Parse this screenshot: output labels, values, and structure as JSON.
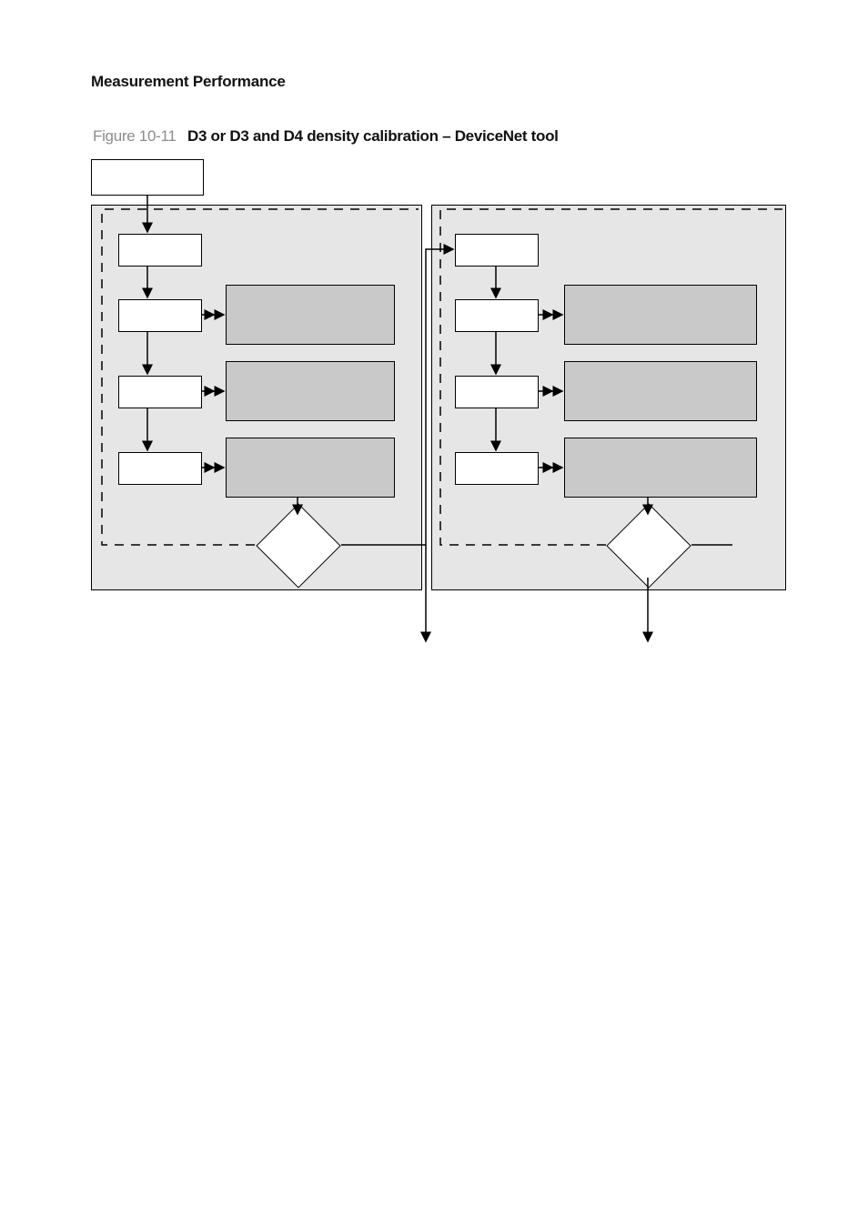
{
  "header": {
    "section": "Measurement Performance"
  },
  "figure": {
    "number": "Figure 10-11",
    "caption": "D3 or D3 and D4 density calibration – DeviceNet tool"
  },
  "chart_data": {
    "type": "diagram",
    "description": "Flowchart showing D3 (left panel) and D4 (right panel) density calibration sequence inside a DeviceNet tool. Left panel output feeds the start of the right-panel sequence.",
    "top_box": {
      "label": ""
    },
    "panels": [
      {
        "id": "d3",
        "side": "left",
        "whiteSteps": 4,
        "grayAnnotations": 3,
        "decision": true,
        "decisionExits": [
          "right-to-next-panel",
          "left-dashed-back-to-panel-top"
        ],
        "labels": {
          "step1": "",
          "step2": "",
          "step3": "",
          "step4": "",
          "anno1": "",
          "anno2": "",
          "anno3": "",
          "decision": ""
        }
      },
      {
        "id": "d4",
        "side": "right",
        "whiteSteps": 4,
        "grayAnnotations": 3,
        "decision": true,
        "decisionExits": [
          "down-to-done",
          "left-dashed-back-to-panel-top"
        ],
        "labels": {
          "step1": "",
          "step2": "",
          "step3": "",
          "step4": "",
          "anno1": "",
          "anno2": "",
          "anno3": "",
          "decision": ""
        }
      }
    ],
    "connections": [
      {
        "from": "top_box",
        "to": "d3.step1",
        "style": "solid"
      },
      {
        "from": "d3.step1",
        "to": "d3.step2",
        "style": "solid"
      },
      {
        "from": "d3.step2",
        "to": "d3.step3",
        "style": "solid"
      },
      {
        "from": "d3.step3",
        "to": "d3.step4",
        "style": "solid"
      },
      {
        "from": "d3.step2",
        "to": "d3.anno1",
        "style": "solid-double-arrow"
      },
      {
        "from": "d3.step3",
        "to": "d3.anno2",
        "style": "solid-double-arrow"
      },
      {
        "from": "d3.step4",
        "to": "d3.anno3",
        "style": "solid-double-arrow"
      },
      {
        "from": "d3.anno3",
        "to": "d3.decision",
        "style": "solid"
      },
      {
        "from": "d3.decision.right",
        "to": "d4.step1",
        "style": "solid"
      },
      {
        "from": "d3.decision.left",
        "to": "d3.panel.top",
        "style": "dashed"
      },
      {
        "from": "d4.step1",
        "to": "d4.step2",
        "style": "solid"
      },
      {
        "from": "d4.step2",
        "to": "d4.step3",
        "style": "solid"
      },
      {
        "from": "d4.step3",
        "to": "d4.step4",
        "style": "solid"
      },
      {
        "from": "d4.step2",
        "to": "d4.anno1",
        "style": "solid-double-arrow"
      },
      {
        "from": "d4.step3",
        "to": "d4.anno2",
        "style": "solid-double-arrow"
      },
      {
        "from": "d4.step4",
        "to": "d4.anno3",
        "style": "solid-double-arrow"
      },
      {
        "from": "d4.anno3",
        "to": "d4.decision",
        "style": "solid"
      },
      {
        "from": "d4.decision.right",
        "to": "done",
        "style": "solid"
      },
      {
        "from": "d4.decision.left",
        "to": "d4.panel.top",
        "style": "dashed"
      }
    ]
  }
}
